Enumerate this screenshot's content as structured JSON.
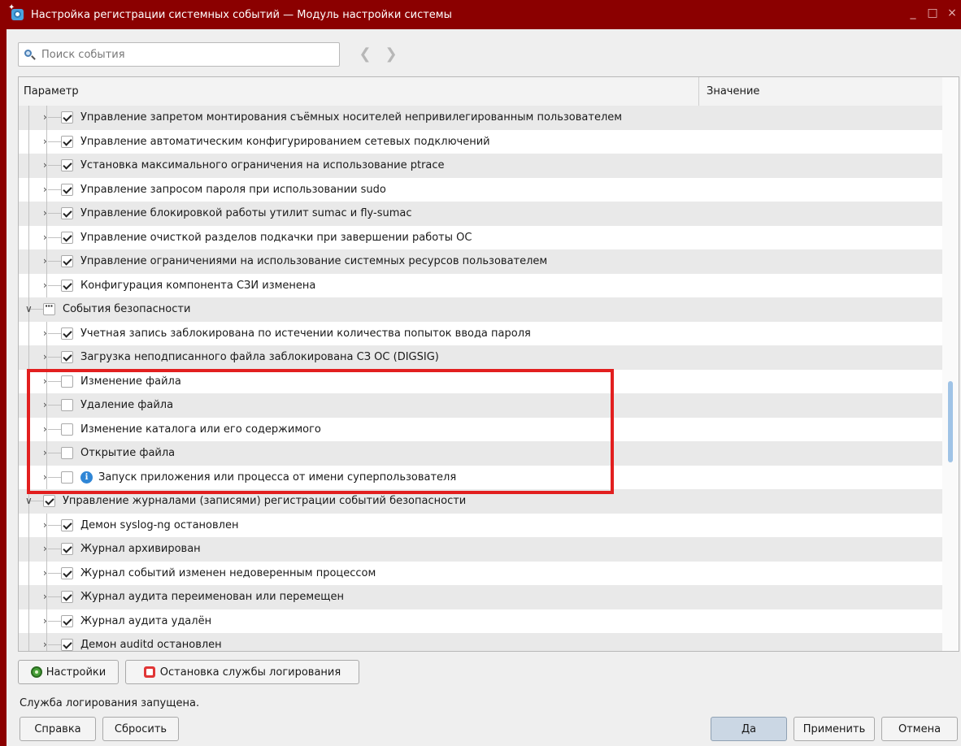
{
  "window": {
    "title": "Настройка регистрации системных событий — Модуль настройки системы",
    "controls": [
      "_",
      "□",
      "×"
    ]
  },
  "search": {
    "placeholder": "Поиск события"
  },
  "columns": {
    "param": "Параметр",
    "value": "Значение"
  },
  "tree_rows": [
    {
      "label": "Управление запретом монтирования съёмных носителей непривилегированным пользователем",
      "level": 1,
      "state": "checked",
      "expander": "collapsed"
    },
    {
      "label": "Управление автоматическим конфигурированием сетевых подключений",
      "level": 1,
      "state": "checked",
      "expander": "collapsed"
    },
    {
      "label": "Установка максимального ограничения на использование ptrace",
      "level": 1,
      "state": "checked",
      "expander": "collapsed"
    },
    {
      "label": "Управление запросом пароля при использовании sudo",
      "level": 1,
      "state": "checked",
      "expander": "collapsed"
    },
    {
      "label": "Управление блокировкой работы утилит sumac и fly-sumac",
      "level": 1,
      "state": "checked",
      "expander": "collapsed"
    },
    {
      "label": "Управление очисткой разделов подкачки при завершении работы ОС",
      "level": 1,
      "state": "checked",
      "expander": "collapsed"
    },
    {
      "label": "Управление ограничениями на использование системных ресурсов пользователем",
      "level": 1,
      "state": "checked",
      "expander": "collapsed"
    },
    {
      "label": "Конфигурация компонента СЗИ изменена",
      "level": 1,
      "state": "checked",
      "expander": "collapsed"
    },
    {
      "label": "События безопасности",
      "level": 0,
      "state": "partial",
      "expander": "expanded"
    },
    {
      "label": "Учетная запись заблокирована по истечении количества попыток ввода пароля",
      "level": 1,
      "state": "checked",
      "expander": "collapsed"
    },
    {
      "label": "Загрузка неподписанного файла заблокирована СЗ ОС (DIGSIG)",
      "level": 1,
      "state": "checked",
      "expander": "collapsed"
    },
    {
      "label": "Изменение файла",
      "level": 1,
      "state": "unchecked",
      "expander": "collapsed"
    },
    {
      "label": "Удаление файла",
      "level": 1,
      "state": "unchecked",
      "expander": "collapsed"
    },
    {
      "label": "Изменение каталога или его содержимого",
      "level": 1,
      "state": "unchecked",
      "expander": "collapsed"
    },
    {
      "label": "Открытие файла",
      "level": 1,
      "state": "unchecked",
      "expander": "collapsed"
    },
    {
      "label": "Запуск приложения или процесса от имени суперпользователя",
      "level": 1,
      "state": "unchecked",
      "expander": "collapsed",
      "icon": "info-icon"
    },
    {
      "label": "Управление журналами (записями) регистрации событий безопасности",
      "level": 0,
      "state": "checked",
      "expander": "expanded"
    },
    {
      "label": "Демон syslog-ng остановлен",
      "level": 1,
      "state": "checked",
      "expander": "collapsed"
    },
    {
      "label": "Журнал архивирован",
      "level": 1,
      "state": "checked",
      "expander": "collapsed"
    },
    {
      "label": "Журнал событий изменен недоверенным процессом",
      "level": 1,
      "state": "checked",
      "expander": "collapsed"
    },
    {
      "label": "Журнал аудита переименован или перемещен",
      "level": 1,
      "state": "checked",
      "expander": "collapsed"
    },
    {
      "label": "Журнал аудита удалён",
      "level": 1,
      "state": "checked",
      "expander": "collapsed"
    },
    {
      "label": "Демон auditd остановлен",
      "level": 1,
      "state": "checked",
      "expander": "collapsed"
    }
  ],
  "service_buttons": {
    "settings": "Настройки",
    "stop_logging": "Остановка службы логирования"
  },
  "status": "Служба логирования запущена.",
  "footer": {
    "help": "Справка",
    "reset": "Сбросить",
    "ok": "Да",
    "apply": "Применить",
    "cancel": "Отмена"
  },
  "colors": {
    "titlebar": "#8b0000",
    "highlight": "#e21f1f",
    "selected_button": "#cbd7e4"
  }
}
